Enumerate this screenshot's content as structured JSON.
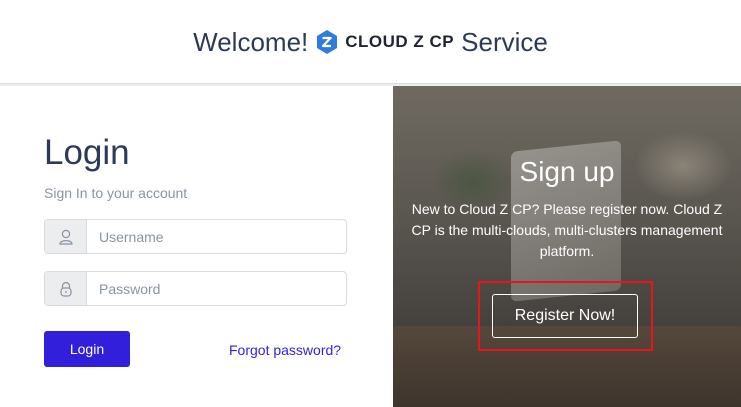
{
  "header": {
    "welcome": "Welcome!",
    "brand_name": "CLOUD Z CP",
    "service": "Service",
    "logo_icon": "hexagon-z-icon",
    "logo_color": "#2f7be0"
  },
  "login": {
    "title": "Login",
    "subtitle": "Sign In to your account",
    "username_placeholder": "Username",
    "password_placeholder": "Password",
    "username_icon": "user-icon",
    "password_icon": "lock-icon",
    "login_button": "Login",
    "forgot_link": "Forgot password?",
    "accent_color": "#321fdb"
  },
  "signup": {
    "title": "Sign up",
    "text": "New to Cloud Z CP? Please register now. Cloud Z CP is the multi-clouds, multi-clusters management platform.",
    "register_button": "Register Now!",
    "highlight_color": "#e8151b"
  }
}
